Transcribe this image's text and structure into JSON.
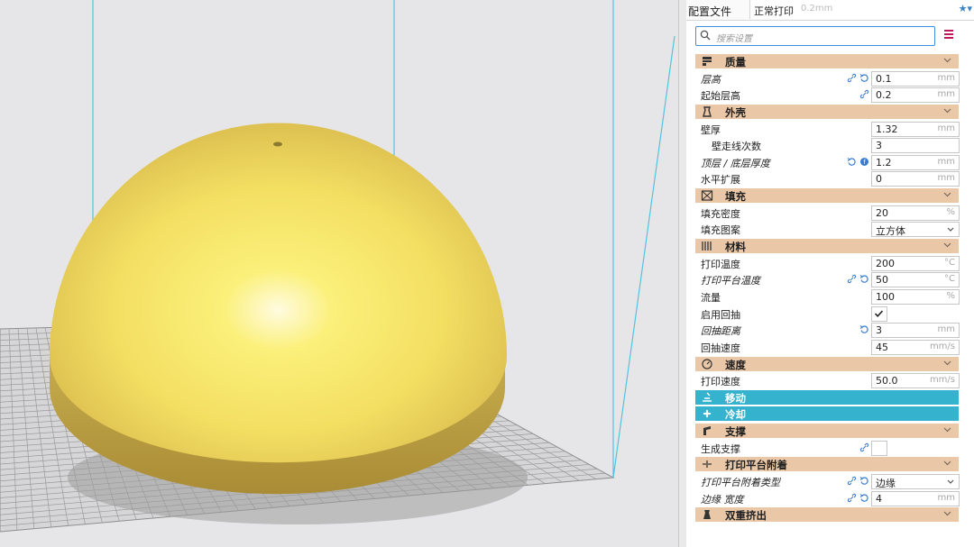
{
  "header": {
    "profile_label": "配置文件",
    "profile_name": "正常打印",
    "profile_sub": "0.2mm",
    "profile_icons": "★▾"
  },
  "search": {
    "placeholder": "搜索设置"
  },
  "colors": {
    "section": "#e9c7a7",
    "section_active": "#35b2ce",
    "model": "#f5e06a",
    "frame": "#4fc3e0",
    "menu": "#c2185b"
  },
  "sections": {
    "quality": {
      "title": "质量",
      "icon": "quality-icon"
    },
    "shell": {
      "title": "外壳",
      "icon": "shell-icon"
    },
    "infill": {
      "title": "填充",
      "icon": "infill-icon"
    },
    "material": {
      "title": "材料",
      "icon": "material-icon"
    },
    "speed": {
      "title": "速度",
      "icon": "speed-icon"
    },
    "travel": {
      "title": "移动",
      "icon": "travel-icon"
    },
    "cooling": {
      "title": "冷却",
      "icon": "fan-icon"
    },
    "support": {
      "title": "支撑",
      "icon": "support-icon"
    },
    "adhesion": {
      "title": "打印平台附着",
      "icon": "adhesion-icon"
    },
    "dual": {
      "title": "双重挤出",
      "icon": "dual-icon"
    }
  },
  "settings": {
    "layer_height": {
      "label": "层高",
      "value": "0.1",
      "unit": "mm"
    },
    "initial_layer_height": {
      "label": "起始层高",
      "value": "0.2",
      "unit": "mm"
    },
    "wall_thickness": {
      "label": "壁厚",
      "value": "1.32",
      "unit": "mm"
    },
    "wall_line_count": {
      "label": "壁走线次数",
      "value": "3",
      "unit": ""
    },
    "top_bottom_thickness": {
      "label": "顶层 / 底层厚度",
      "value": "1.2",
      "unit": "mm"
    },
    "horizontal_expansion": {
      "label": "水平扩展",
      "value": "0",
      "unit": "mm"
    },
    "infill_density": {
      "label": "填充密度",
      "value": "20",
      "unit": "%"
    },
    "infill_pattern": {
      "label": "填充图案",
      "value": "立方体"
    },
    "print_temperature": {
      "label": "打印温度",
      "value": "200",
      "unit": "°C"
    },
    "bed_temperature": {
      "label": "打印平台温度",
      "value": "50",
      "unit": "°C"
    },
    "flow": {
      "label": "流量",
      "value": "100",
      "unit": "%"
    },
    "retraction_enable": {
      "label": "启用回抽",
      "checked": true
    },
    "retraction_distance": {
      "label": "回抽距离",
      "value": "3",
      "unit": "mm"
    },
    "retraction_speed": {
      "label": "回抽速度",
      "value": "45",
      "unit": "mm/s"
    },
    "print_speed": {
      "label": "打印速度",
      "value": "50.0",
      "unit": "mm/s"
    },
    "support_enable": {
      "label": "生成支撑",
      "checked": false
    },
    "adhesion_type": {
      "label": "打印平台附着类型",
      "value": "边缘"
    },
    "brim_width": {
      "label": "边缘 宽度",
      "value": "4",
      "unit": "mm"
    }
  }
}
